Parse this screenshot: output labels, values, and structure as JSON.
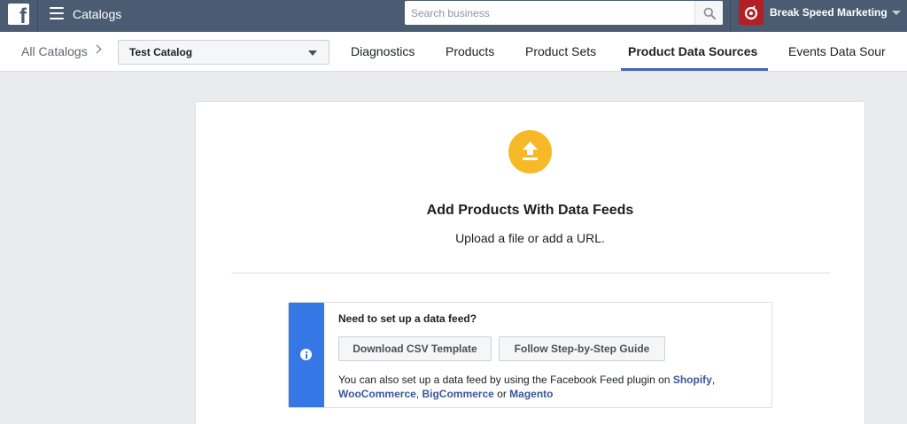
{
  "topbar": {
    "logo_letter": "f",
    "app_title": "Catalogs",
    "search_placeholder": "Search business",
    "business_name": "Break Speed Marketing"
  },
  "subnav": {
    "breadcrumb": "All Catalogs",
    "catalog_selected": "Test Catalog",
    "tabs": [
      {
        "label": "Diagnostics"
      },
      {
        "label": "Products"
      },
      {
        "label": "Product Sets"
      },
      {
        "label": "Product Data Sources",
        "active": true
      },
      {
        "label": "Events Data Sour"
      }
    ]
  },
  "card": {
    "title": "Add Products With Data Feeds",
    "subtitle": "Upload a file or add a URL.",
    "info": {
      "heading": "Need to set up a data feed?",
      "btn_csv": "Download CSV Template",
      "btn_guide": "Follow Step-by-Step Guide",
      "text_prefix": "You can also set up a data feed by using the Facebook Feed plugin on ",
      "link_shopify": "Shopify",
      "sep1": ",",
      "link_woocommerce": "WooCommerce",
      "sep2": ", ",
      "link_bigcommerce": "BigCommerce",
      "sep3": " or ",
      "link_magento": "Magento"
    }
  },
  "colors": {
    "topbar": "#4b5c72",
    "accent": "#4267b2",
    "info_bar": "#3578e5",
    "upload_icon": "#f7b928",
    "brand_avatar": "#b21f24"
  },
  "icons": [
    "facebook-logo-icon",
    "hamburger-menu-icon",
    "search-icon",
    "brand-avatar-icon",
    "caret-down-icon",
    "chevron-right-icon",
    "upload-icon",
    "info-icon"
  ]
}
